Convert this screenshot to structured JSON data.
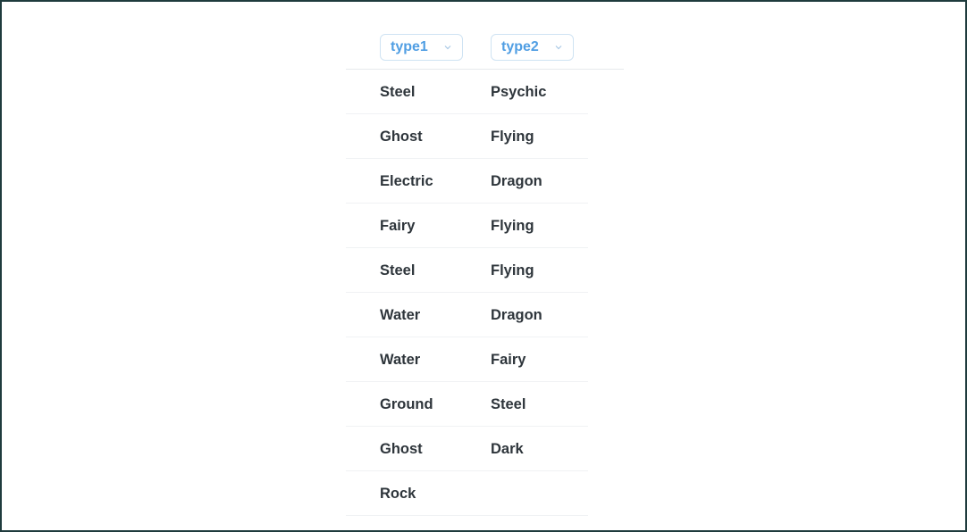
{
  "table": {
    "columns": [
      {
        "label": "type1",
        "icon": "chevron-down-icon"
      },
      {
        "label": "type2",
        "icon": "chevron-down-icon"
      }
    ],
    "rows": [
      {
        "type1": "Steel",
        "type2": "Psychic"
      },
      {
        "type1": "Ghost",
        "type2": "Flying"
      },
      {
        "type1": "Electric",
        "type2": "Dragon"
      },
      {
        "type1": "Fairy",
        "type2": "Flying"
      },
      {
        "type1": "Steel",
        "type2": "Flying"
      },
      {
        "type1": "Water",
        "type2": "Dragon"
      },
      {
        "type1": "Water",
        "type2": "Fairy"
      },
      {
        "type1": "Ground",
        "type2": "Steel"
      },
      {
        "type1": "Ghost",
        "type2": "Dark"
      },
      {
        "type1": "Rock",
        "type2": ""
      }
    ]
  },
  "colors": {
    "header_accent": "#509ee3",
    "text": "#2e353b",
    "frame_border": "#1f3b3d"
  }
}
